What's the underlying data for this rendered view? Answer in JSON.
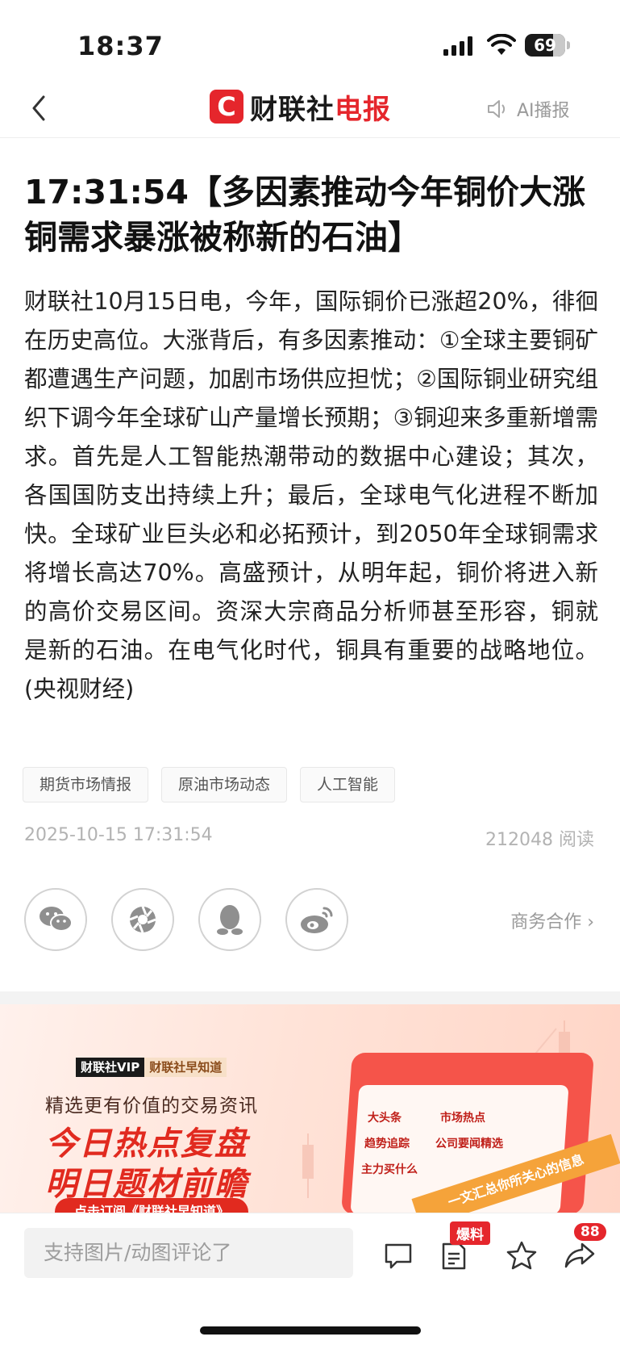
{
  "status_bar": {
    "time": "18:37",
    "battery": "69",
    "battery_level": 0.69
  },
  "nav": {
    "logo_mark": "C",
    "logo_text_a": "财联社",
    "logo_text_b": "电报",
    "ai_label": "AI播报"
  },
  "article": {
    "headline": "17:31:54【多因素推动今年铜价大涨 铜需求暴涨被称新的石油】",
    "body": "财联社10月15日电，今年，国际铜价已涨超20%，徘徊在历史高位。大涨背后，有多因素推动：①全球主要铜矿都遭遇生产问题，加剧市场供应担忧；②国际铜业研究组织下调今年全球矿山产量增长预期；③铜迎来多重新增需求。首先是人工智能热潮带动的数据中心建设；其次，各国国防支出持续上升；最后，全球电气化进程不断加快。全球矿业巨头必和必拓预计，到2050年全球铜需求将增长高达70%。高盛预计，从明年起，铜价将进入新的高价交易区间。资深大宗商品分析师甚至形容，铜就是新的石油。在电气化时代，铜具有重要的战略地位。(央视财经)",
    "tags": [
      "期货市场情报",
      "原油市场动态",
      "人工智能"
    ],
    "date": "2025-10-15 17:31:54",
    "reads": "212048 阅读"
  },
  "share": {
    "items": [
      "wechat-icon",
      "moments-icon",
      "qq-icon",
      "weibo-icon"
    ],
    "business_label": "商务合作 ›"
  },
  "banner": {
    "tag_a": "财联社VIP",
    "tag_b": "财联社早知道",
    "subtitle": "精选更有价值的交易资讯",
    "line1": "今日热点复盘",
    "line2": "明日题材前瞻",
    "button": "点击订阅《财联社早知道》",
    "items": [
      "大头条",
      "市场热点",
      "趋势追踪",
      "公司要闻精选",
      "主力买什么"
    ],
    "ribbon": "一文汇总你所关心的信息"
  },
  "bottom": {
    "comment_placeholder": "支持图片/动图评论了",
    "tip_badge": "爆料",
    "share_count": "88"
  }
}
